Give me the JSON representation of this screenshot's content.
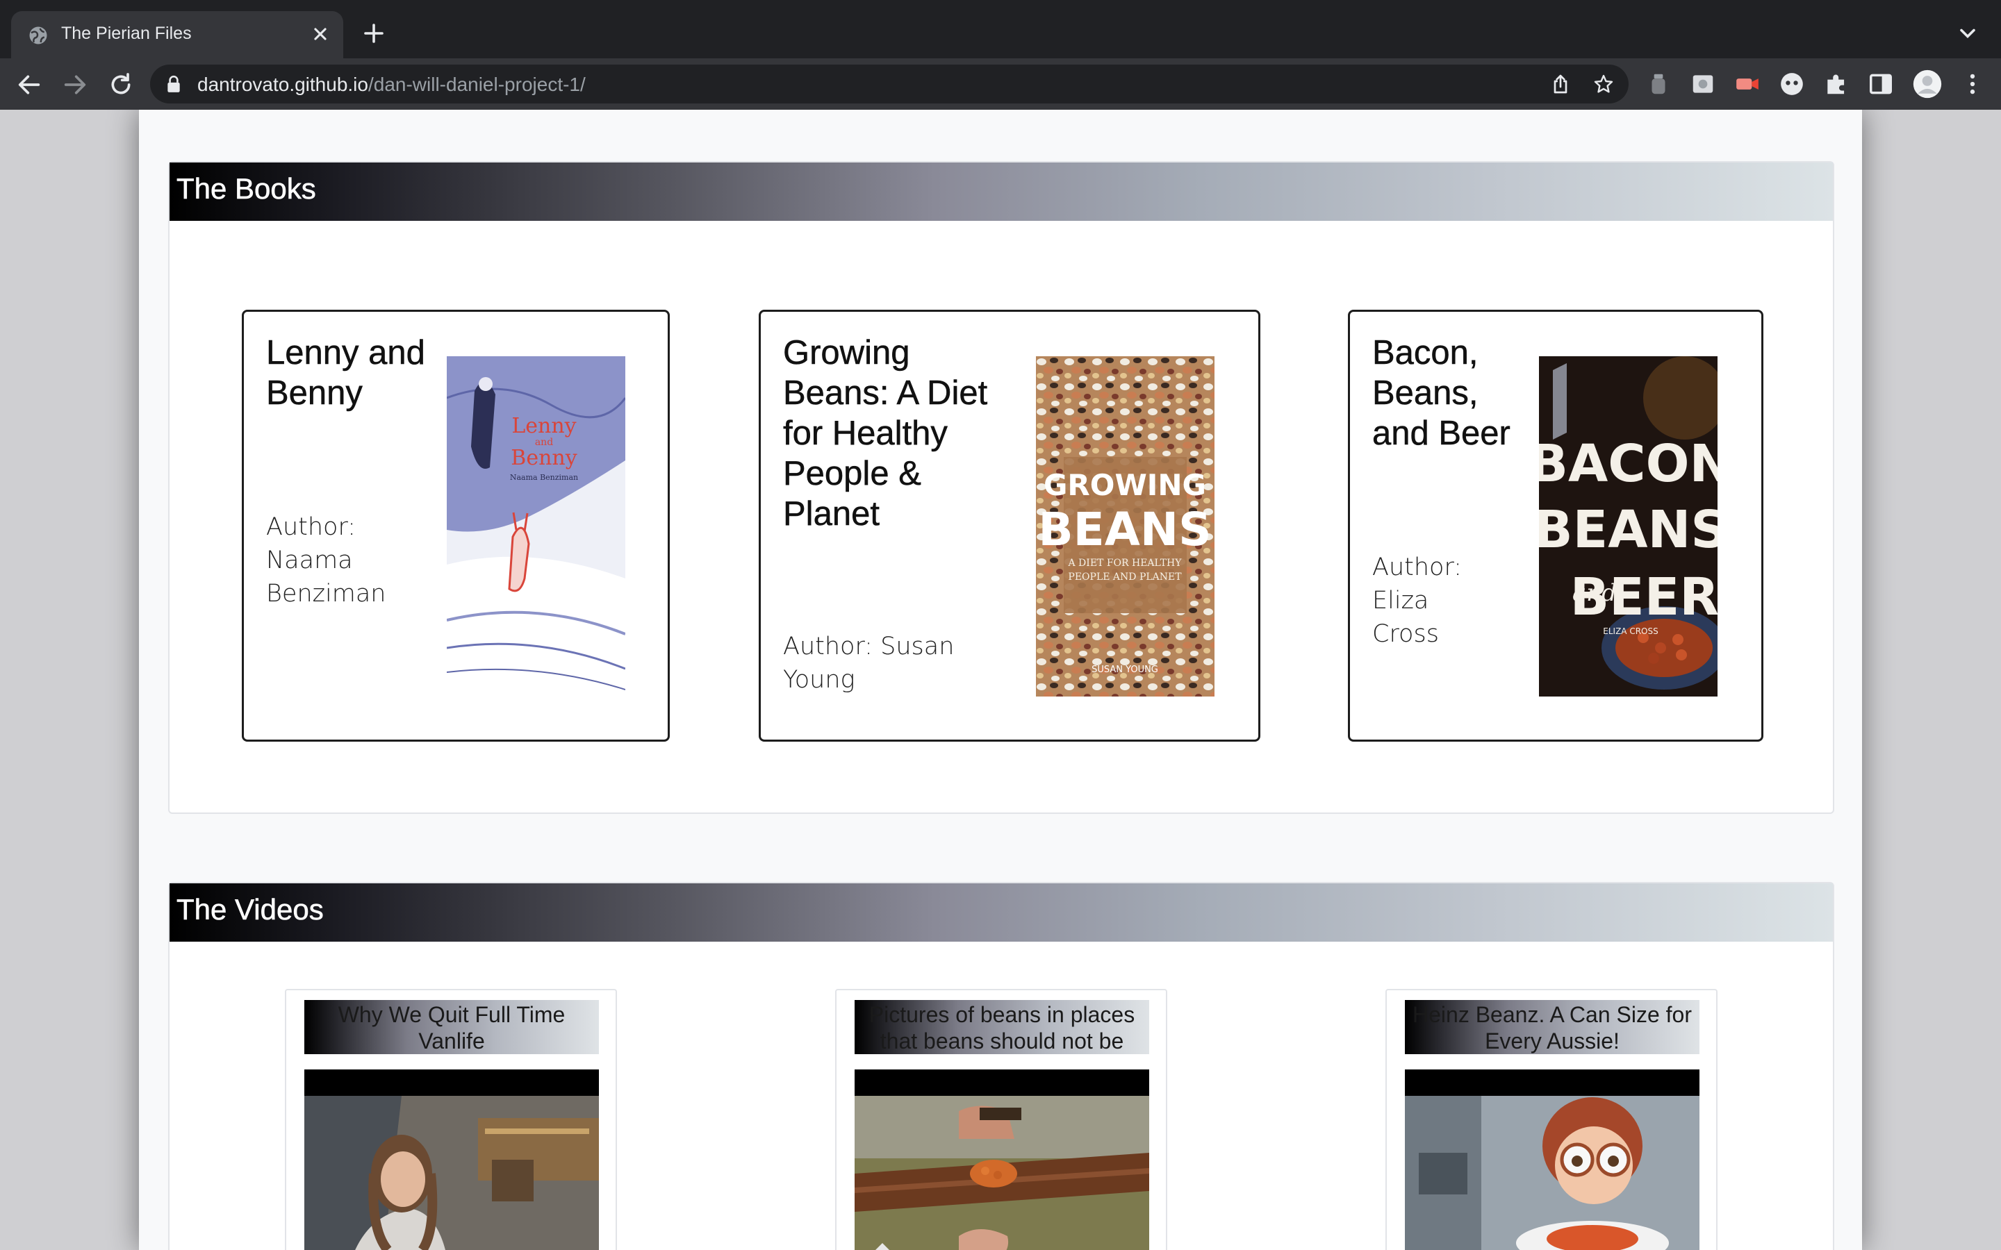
{
  "browser": {
    "tab_title": "The Pierian Files",
    "url_host": "dantrovato.github.io",
    "url_path": "/dan-will-daniel-project-1/"
  },
  "books_section": {
    "title": "The Books",
    "books": [
      {
        "title": "Lenny and Benny",
        "author": "Author: Naama Benziman"
      },
      {
        "title": "Growing Beans: A Diet for Healthy People & Planet",
        "author": "Author: Susan Young"
      },
      {
        "title": "Bacon, Beans, and Beer",
        "author": "Author: Eliza Cross"
      }
    ]
  },
  "covers": {
    "lenny": {
      "line1": "Lenny",
      "line2": "and",
      "line3": "Benny",
      "author": "Naama Benziman"
    },
    "growing": {
      "line1": "GROWING",
      "line2": "BEANS",
      "subtitle1": "A DIET FOR HEALTHY",
      "subtitle2": "PEOPLE AND PLANET",
      "author": "SUSAN YOUNG"
    },
    "bacon": {
      "line1": "BACON",
      "line2": "BEANS",
      "line3": "BEER",
      "and": "and",
      "author": "ELIZA CROSS"
    }
  },
  "videos_section": {
    "title": "The Videos",
    "videos": [
      {
        "title": "Why We Quit Full Time Vanlife"
      },
      {
        "title": "Pictures of beans in places that beans should not be"
      },
      {
        "title": "Heinz Beanz. A Can Size for Every Aussie!"
      }
    ]
  },
  "colors": {
    "chrome_dark": "#202124",
    "chrome_toolbar": "#35363a",
    "header_gradient_start": "#000000",
    "header_gradient_end": "#dce3e6"
  }
}
